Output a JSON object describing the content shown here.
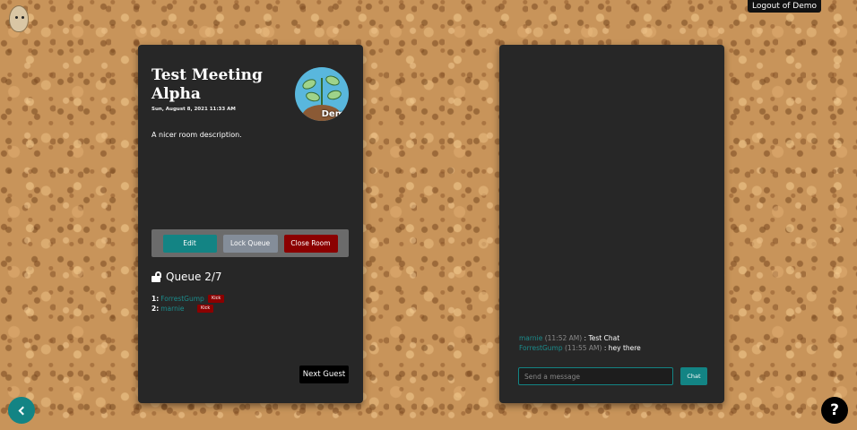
{
  "header": {
    "logout_label": "Logout of Demo"
  },
  "room": {
    "title": "Test Meeting Alpha",
    "date": "Sun, August 8, 2021 11:33 AM",
    "avatar_label": "Demo",
    "description": "A nicer room description.",
    "buttons": {
      "edit": "Edit",
      "lock_queue": "Lock Queue",
      "close_room": "Close Room"
    },
    "queue": {
      "title": "Queue 2/7",
      "kick_label": "Kick",
      "items": [
        {
          "num": "1:",
          "name": "ForrestGump"
        },
        {
          "num": "2:",
          "name": "marnie"
        }
      ]
    },
    "next_guest_label": "Next Guest"
  },
  "chat": {
    "messages": [
      {
        "user": "marnie",
        "time": "(11:52 AM)",
        "sep": " : ",
        "text": "Test Chat"
      },
      {
        "user": "ForrestGump",
        "time": "(11:55 AM)",
        "sep": " : ",
        "text": "hey there"
      }
    ],
    "input_placeholder": "Send a message",
    "send_label": "Chat"
  },
  "icons": {
    "back": "chevron-left-icon",
    "help": "?"
  },
  "colors": {
    "teal": "#138484",
    "danger": "#8b0000",
    "panel": "#272727"
  }
}
